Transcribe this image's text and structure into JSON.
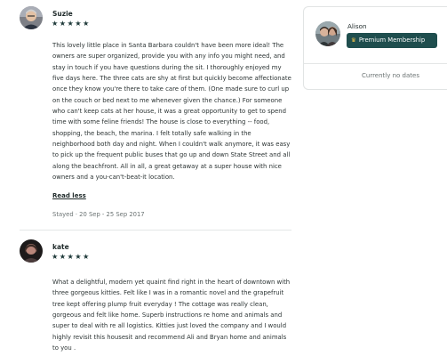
{
  "reviews": [
    {
      "name": "Suzie",
      "stars": "★★★★★",
      "text": "This lovely little place in Santa Barbara couldn't have been more ideal! The owners are super organized, provide you with any info you might need, and stay in touch if you have questions during the sit. I thoroughly enjoyed my five days here. The three cats are shy at first but quickly become affectionate once they know you're there to take care of them. (One made sure to curl up on the couch or bed next to me whenever given the chance.) For someone who can't keep cats at her house, it was a great opportunity to get to spend time with some feline friends! The house is close to everything -- food, shopping, the beach, the marina. I felt totally safe walking in the neighborhood both day and night. When I couldn't walk anymore, it was easy to pick up the frequent public buses that go up and down State Street and all along the beachfront. All in all, a great getaway at a super house with nice owners and a you-can't-beat-it location.",
      "read_less": "Read less",
      "stayed": "Stayed · 20 Sep - 25 Sep 2017"
    },
    {
      "name": "kate",
      "stars": "★★★★★",
      "text": "What a delightful, modern yet quaint find right in the heart of downtown with three gorgeous kitties. Felt like I was in a romantic novel and the grapefruit tree kept offering plump fruit everyday ! The cottage was really clean, gorgeous and felt like home. Superb instructions re home and animals and super to deal with re all logistics. Kitties just loved the company and I would highly revisit this housesit and recommend Ali and Bryan home and animals to you ."
    }
  ],
  "sidebar": {
    "name": "Alison",
    "membership_label": "Premium Membership",
    "membership_icon": "crown-icon",
    "dates_text": "Currently no dates"
  },
  "colors": {
    "membership_bg": "#1f4e4e",
    "stars": "#1f3a3a"
  }
}
